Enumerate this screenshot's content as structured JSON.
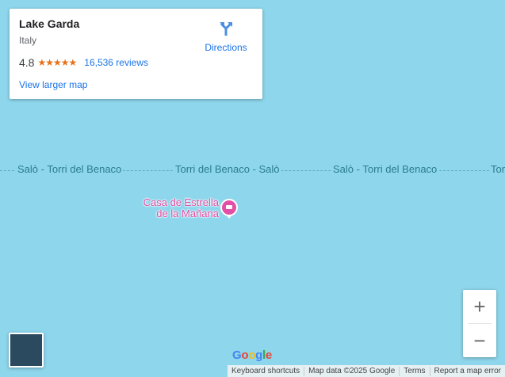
{
  "place_card": {
    "title": "Lake Garda",
    "subtitle": "Italy",
    "rating": "4.8",
    "stars": "★★★★★",
    "reviews": "16,536 reviews",
    "view_larger": "View larger map",
    "directions_label": "Directions"
  },
  "map": {
    "water_color": "#8ed6ec",
    "ferry_labels": [
      "Salò - Torri del Benaco",
      "Torri del Benaco - Salò",
      "Salò - Torri del Benaco",
      "Tor"
    ],
    "poi": {
      "line1": "Casa de Estrella",
      "line2": "de la Mañana",
      "icon": "hotel-bed-icon",
      "color": "#e24fa5"
    }
  },
  "controls": {
    "zoom_in": "+",
    "zoom_out": "−"
  },
  "logo": {
    "letters": [
      "G",
      "o",
      "o",
      "g",
      "l",
      "e"
    ]
  },
  "attribution": [
    "Keyboard shortcuts",
    "Map data ©2025 Google",
    "Terms",
    "Report a map error"
  ]
}
